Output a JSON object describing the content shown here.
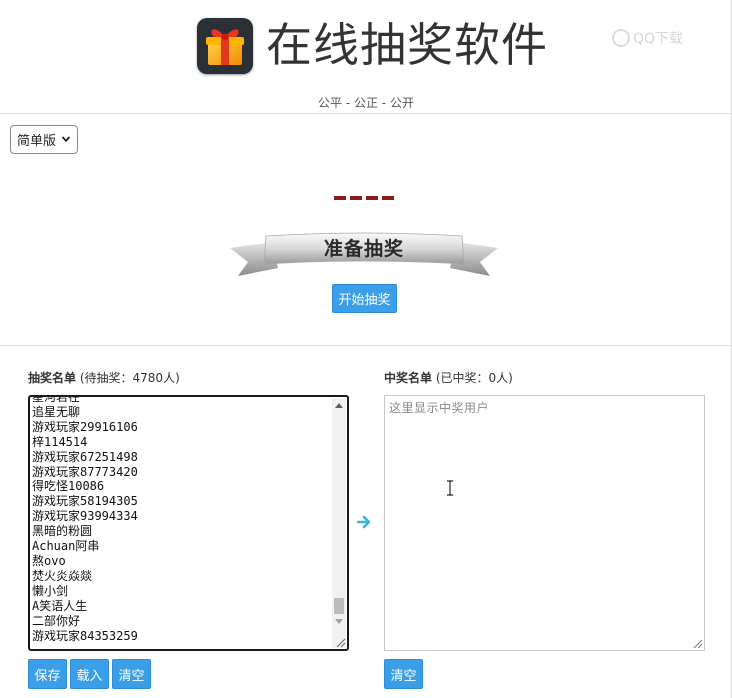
{
  "header": {
    "title": "在线抽奖软件",
    "subtitle": "公平 - 公正 - 公开",
    "watermark": "QQ下载"
  },
  "version_select": {
    "selected": "简单版"
  },
  "draw": {
    "status_label": "准备抽奖",
    "start_button": "开始抽奖"
  },
  "pool": {
    "label": "抽奖名单",
    "count_text": "(待抽奖：4780人)",
    "names": [
      "星河若在",
      "追星无聊",
      "游戏玩家29916106",
      "梓114514",
      "游戏玩家67251498",
      "游戏玩家87773420",
      "得吃怪10086",
      "游戏玩家58194305",
      "游戏玩家93994334",
      "黑暗的粉圆",
      "Achuan阿串",
      "熬ovo",
      "焚火炎焱燚",
      "懒小剑",
      "A笑语人生",
      "二部你好",
      "游戏玩家84353259"
    ],
    "buttons": {
      "save": "保存",
      "load": "载入",
      "clear": "清空"
    }
  },
  "winners": {
    "label": "中奖名单",
    "count_text": "(已中奖：0人)",
    "placeholder": "这里显示中奖用户",
    "clear_button": "清空"
  },
  "colors": {
    "button_blue": "#3a9ee8",
    "slot_dash": "#8b1a1a",
    "arrow": "#37b6d8"
  }
}
